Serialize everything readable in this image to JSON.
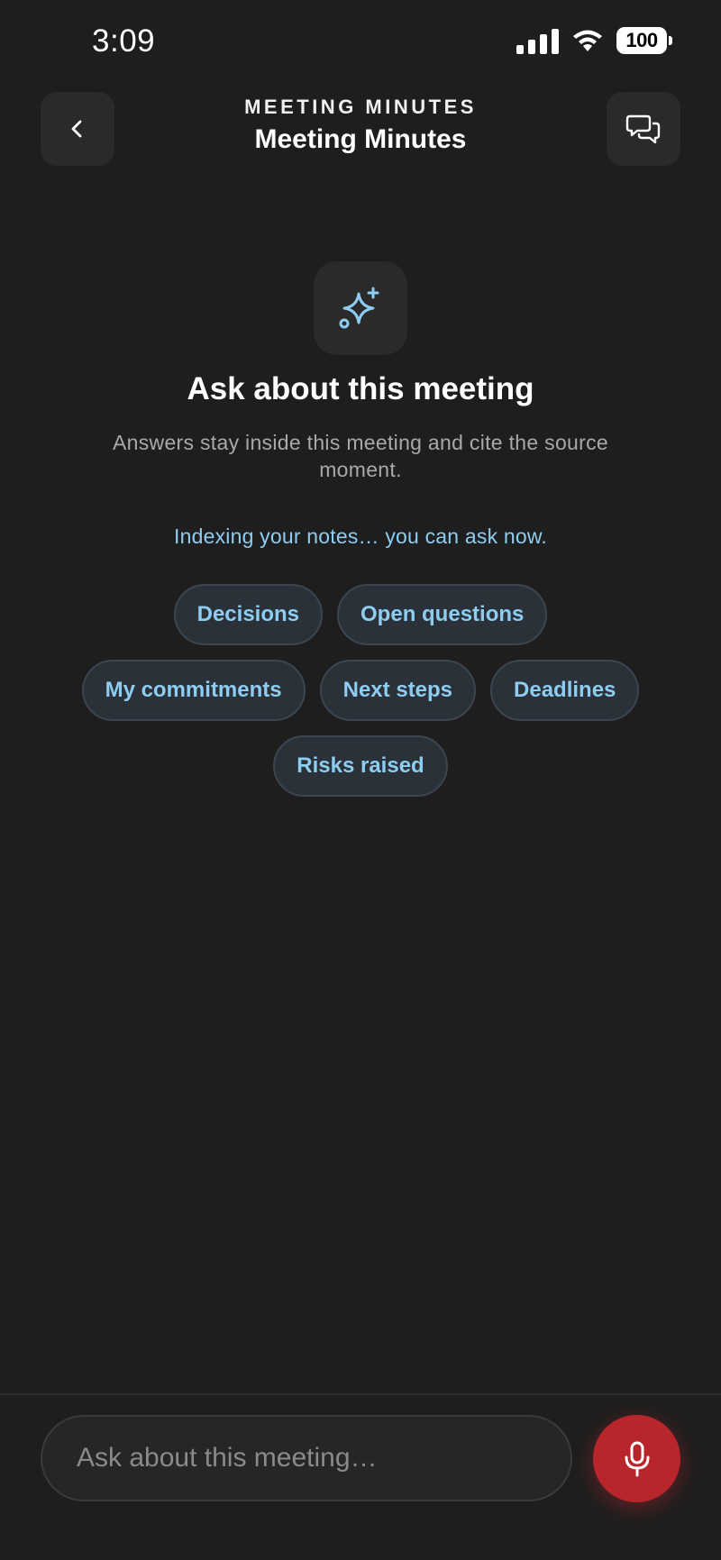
{
  "status_bar": {
    "time": "3:09",
    "battery": "100"
  },
  "header": {
    "overline": "MEETING MINUTES",
    "title": "Meeting Minutes"
  },
  "hero": {
    "title": "Ask about this meeting",
    "subtitle": "Answers stay inside this meeting and cite the source moment.",
    "status": "Indexing your notes… you can ask now."
  },
  "chips": [
    "Decisions",
    "Open questions",
    "My commitments",
    "Next steps",
    "Deadlines",
    "Risks raised"
  ],
  "composer": {
    "placeholder": "Ask about this meeting…"
  },
  "colors": {
    "background": "#1e1e1e",
    "accent": "#8ecdf2",
    "mic": "#b8252b"
  },
  "icons": {
    "back": "chevron-left-icon",
    "chat": "chat-bubbles-icon",
    "hero": "sparkle-icon",
    "mic": "microphone-icon"
  }
}
